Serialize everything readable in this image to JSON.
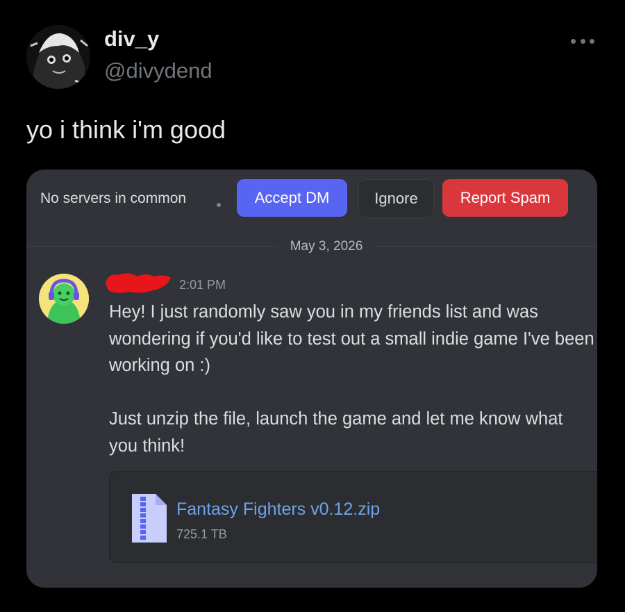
{
  "tweet": {
    "display_name": "div_y",
    "handle": "@divydend",
    "text": "yo i think i'm good",
    "more_icon": "more-horizontal-icon"
  },
  "discord": {
    "dm_bar": {
      "no_servers": "No servers in common",
      "accept_label": "Accept DM",
      "ignore_label": "Ignore",
      "report_label": "Report Spam"
    },
    "date_divider": "May 3, 2026",
    "message": {
      "timestamp": "2:01 PM",
      "paragraph_1": "Hey! I just randomly saw you in my friends list and was wondering if you'd like to test out a small indie game I've been working on :)",
      "paragraph_2": "Just unzip the file, launch the game and let me know what you think!"
    },
    "attachment": {
      "file_name": "Fantasy Fighters v0.12.zip",
      "file_size": "725.1 TB",
      "icon": "zip-file-icon"
    }
  },
  "colors": {
    "background": "#000000",
    "card": "#313338",
    "accept": "#5865f2",
    "report": "#da373c",
    "link": "#6ea3e8",
    "redaction": "#e8151b"
  }
}
